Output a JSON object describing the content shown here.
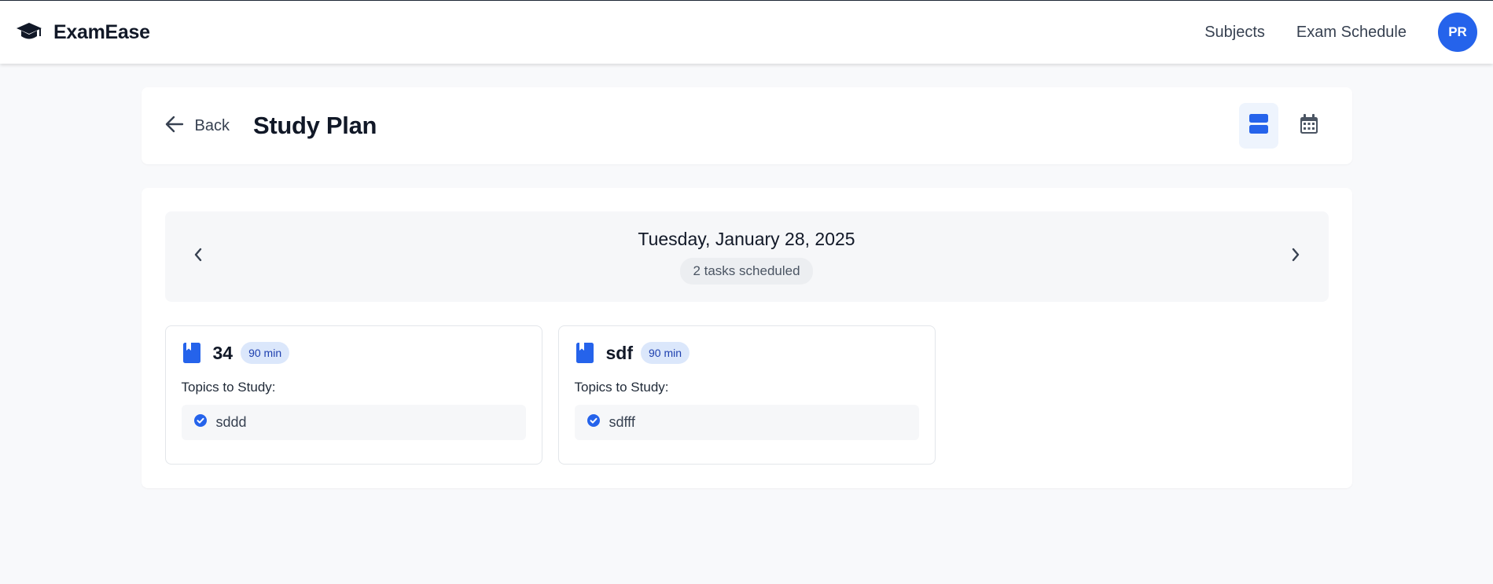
{
  "nav": {
    "brand": "ExamEase",
    "links": [
      "Subjects",
      "Exam Schedule"
    ],
    "avatar_initials": "PR"
  },
  "header": {
    "back_label": "Back",
    "title": "Study Plan"
  },
  "date_nav": {
    "date": "Tuesday, January 28, 2025",
    "task_count": "2 tasks scheduled"
  },
  "tasks": [
    {
      "subject": "34",
      "duration": "90 min",
      "topics_label": "Topics to Study:",
      "topics": [
        "sddd"
      ]
    },
    {
      "subject": "sdf",
      "duration": "90 min",
      "topics_label": "Topics to Study:",
      "topics": [
        "sdfff"
      ]
    }
  ],
  "colors": {
    "accent": "#2563eb",
    "background": "#f8f9fb",
    "badge_bg": "#dbe7fb"
  },
  "icons": {
    "brand": "graduation-cap-icon",
    "back": "arrow-left-icon",
    "list_view": "list-view-icon",
    "calendar_view": "calendar-icon",
    "prev": "chevron-left-icon",
    "next": "chevron-right-icon",
    "task": "book-icon",
    "topic": "check-circle-icon"
  }
}
